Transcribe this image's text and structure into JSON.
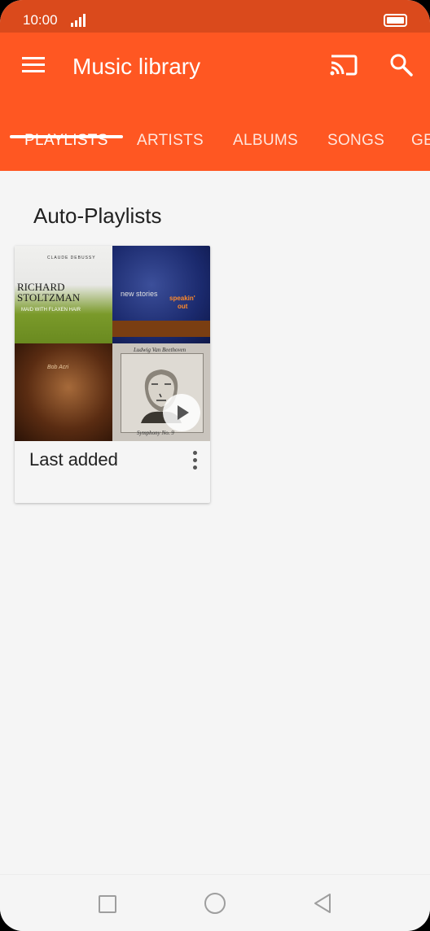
{
  "status_bar": {
    "time": "10:00"
  },
  "app_bar": {
    "title": "Music library",
    "tabs": [
      {
        "label": "PLAYLISTS",
        "active": true
      },
      {
        "label": "ARTISTS",
        "active": false
      },
      {
        "label": "ALBUMS",
        "active": false
      },
      {
        "label": "SONGS",
        "active": false
      },
      {
        "label": "GE",
        "active": false
      }
    ]
  },
  "section": {
    "title": "Auto-Playlists"
  },
  "playlist_card": {
    "label": "Last added",
    "covers": [
      {
        "top_text": "CLAUDE DEBUSSY",
        "artist": "RICHARD STOLTZMAN",
        "album": "MAID WITH FLAXEN HAIR"
      },
      {
        "line1": "new stories",
        "line2": "speakin'",
        "line3": "out"
      },
      {
        "line1": "Bob Acri"
      },
      {
        "line1": "Ludwig Van Beethoven",
        "line2": "Symphony No. 9"
      }
    ]
  },
  "colors": {
    "status_bar": "#da4a1c",
    "app_bar": "#ff5722",
    "background": "#f5f5f5"
  }
}
